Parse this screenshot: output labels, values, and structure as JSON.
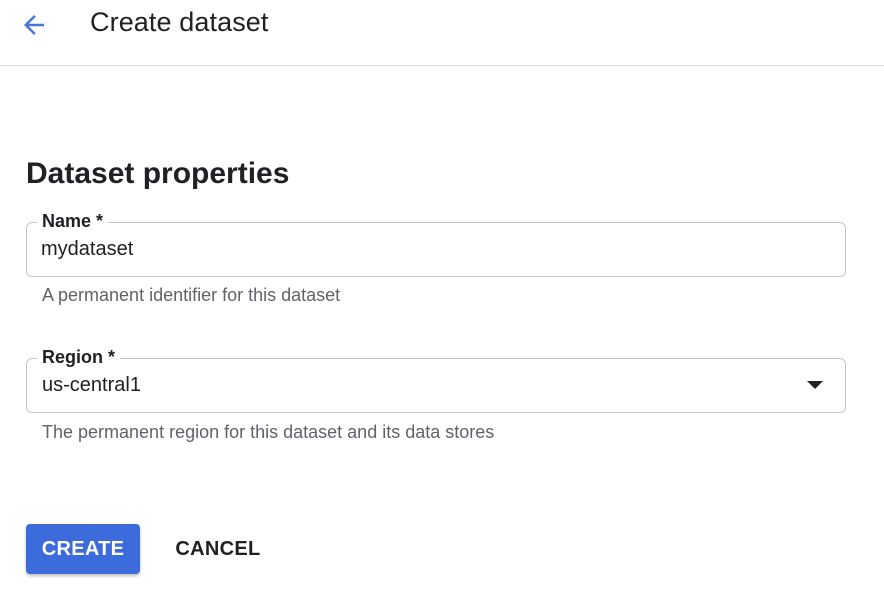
{
  "header": {
    "back_icon": "arrow-back-icon",
    "title": "Create dataset"
  },
  "section": {
    "title": "Dataset properties"
  },
  "fields": {
    "name": {
      "label": "Name *",
      "value": "mydataset",
      "hint": "A permanent identifier for this dataset"
    },
    "region": {
      "label": "Region *",
      "value": "us-central1",
      "dropdown_icon": "arrow-drop-down-icon",
      "hint": "The permanent region for this dataset and its data stores"
    }
  },
  "actions": {
    "create_label": "CREATE",
    "cancel_label": "CANCEL"
  },
  "colors": {
    "accent": "#3c6bdb",
    "back_arrow": "#4a76d8",
    "text": "#202124",
    "hint_text": "#5f6368",
    "border": "#c6c6c6"
  }
}
